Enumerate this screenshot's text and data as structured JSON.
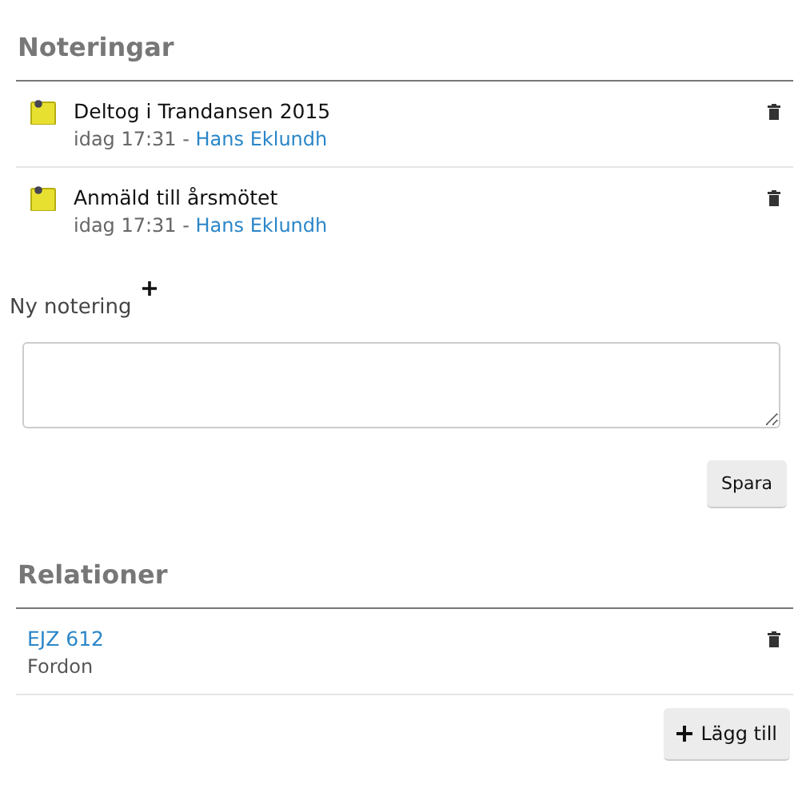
{
  "notes_section": {
    "title": "Noteringar",
    "notes": [
      {
        "text": "Deltog i Trandansen 2015",
        "time": "idag 17:31",
        "separator": " - ",
        "author": "Hans Eklundh"
      },
      {
        "text": "Anmäld till årsmötet",
        "time": "idag 17:31",
        "separator": " - ",
        "author": "Hans Eklundh"
      }
    ],
    "new_note": {
      "label": "Ny notering",
      "save_button": "Spara"
    }
  },
  "relations_section": {
    "title": "Relationer",
    "relations": [
      {
        "name": "EJZ 612",
        "type": "Fordon"
      }
    ],
    "add_button": "Lägg till"
  }
}
